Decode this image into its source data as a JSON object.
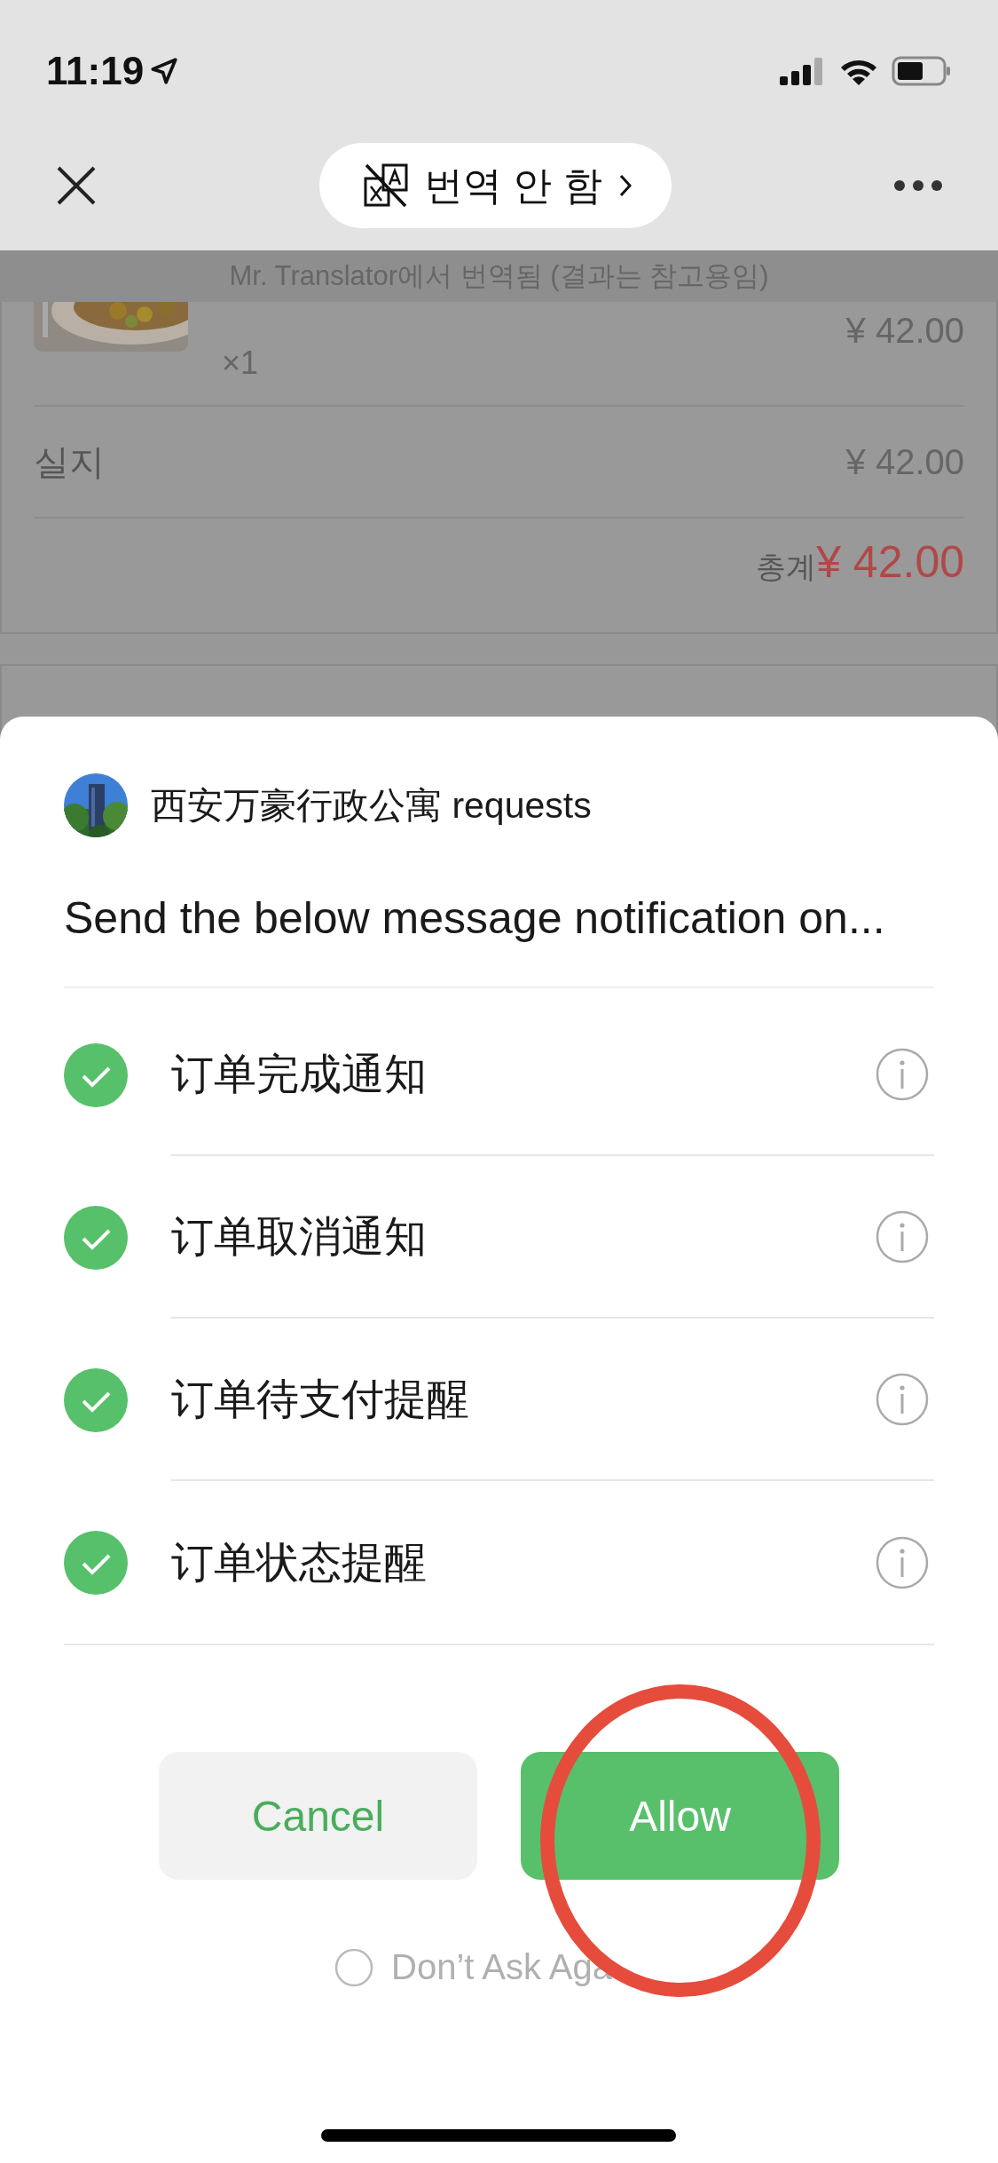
{
  "status_bar": {
    "time": "11:19"
  },
  "nav": {
    "translate_label": "번역 안 함"
  },
  "translation_notice": "Mr. Translator에서 번역됨 (결과는 참고용임)",
  "order": {
    "item": {
      "kind": "picture",
      "quantity": "×1",
      "price": "¥ 42.00"
    },
    "rows": [
      {
        "label": "실지",
        "value": "¥ 42.00"
      }
    ],
    "total": {
      "label": "총계",
      "value": "¥ 42.00"
    }
  },
  "sheet": {
    "app_name": "西安万豪行政公寓 requests",
    "message": "Send the below message notification on...",
    "items": [
      {
        "label": "订单完成通知",
        "checked": true
      },
      {
        "label": "订单取消通知",
        "checked": true
      },
      {
        "label": "订单待支付提醒",
        "checked": true
      },
      {
        "label": "订单状态提醒",
        "checked": true
      }
    ],
    "buttons": [
      {
        "label": "Cancel",
        "kind": "secondary"
      },
      {
        "label": "Allow",
        "kind": "primary"
      }
    ],
    "dont_ask_again": {
      "label": "Don’t Ask Aga",
      "checked": false
    }
  }
}
